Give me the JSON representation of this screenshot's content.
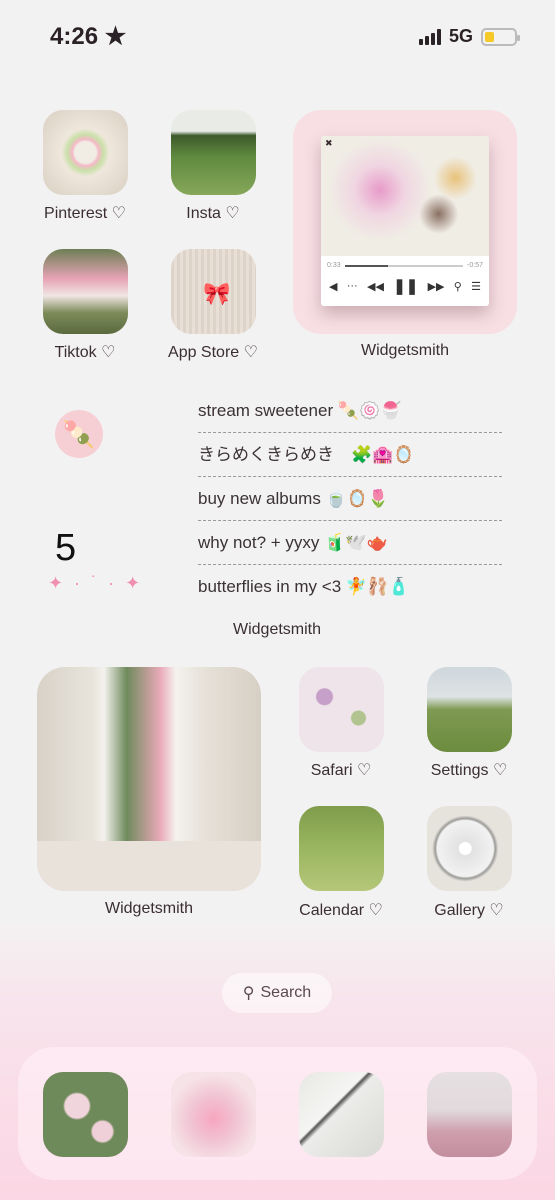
{
  "status": {
    "time": "4:26",
    "focus_icon": "star-icon",
    "network": "5G",
    "battery_color": "#f4c928"
  },
  "apps": [
    {
      "label": "Pinterest ♡"
    },
    {
      "label": "Insta ♡"
    },
    {
      "label": "Tiktok ♡"
    },
    {
      "label": "App Store ♡"
    },
    {
      "label": "Safari ♡"
    },
    {
      "label": "Settings ♡"
    },
    {
      "label": "Calendar ♡"
    },
    {
      "label": "Gallery ♡"
    }
  ],
  "music_widget": {
    "label": "Widgetsmith",
    "elapsed": "0:33",
    "remaining": "-0:57",
    "progress": 0.37
  },
  "todo_widget": {
    "label": "Widgetsmith",
    "count": "5",
    "sparkles": "✦ · ˙ · ✦",
    "items": [
      "stream sweetener 🍡🍥🍧",
      "きらめくきらめき　🧩🏩🪞",
      "buy new albums 🍵🪞🌷",
      "why not?  + yyxy 🧃🕊️🫖",
      "butterflies in my <3 🧚🩰🧴"
    ]
  },
  "photo_widget": {
    "label": "Widgetsmith"
  },
  "search": {
    "label": "Search"
  },
  "dock": {
    "count": 4
  }
}
